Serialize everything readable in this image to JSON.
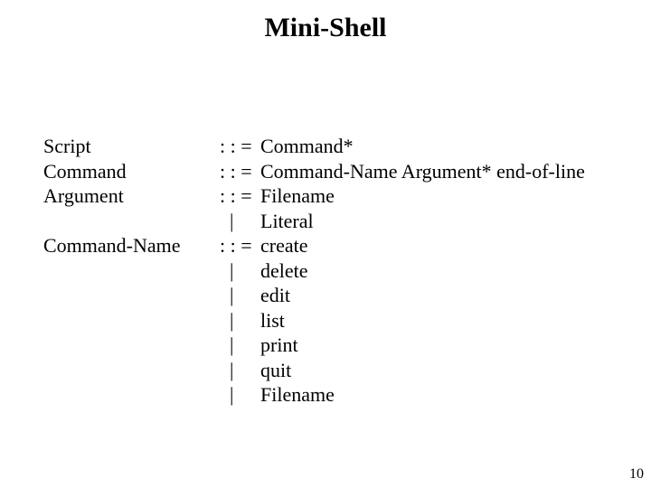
{
  "title": "Mini-Shell",
  "grammar": {
    "rows": [
      {
        "lhs": "Script",
        "op": ": : =",
        "rhs": "Command*"
      },
      {
        "lhs": "Command",
        "op": ": : =",
        "rhs": "Command-Name Argument* end-of-line"
      },
      {
        "lhs": "Argument",
        "op": ": : =",
        "rhs": "Filename"
      },
      {
        "lhs": "",
        "op": "  |",
        "rhs": "Literal"
      },
      {
        "lhs": "Command-Name",
        "op": ": : =",
        "rhs": "create"
      },
      {
        "lhs": "",
        "op": "  |",
        "rhs": "delete"
      },
      {
        "lhs": "",
        "op": "  |",
        "rhs": "edit"
      },
      {
        "lhs": "",
        "op": "  |",
        "rhs": "list"
      },
      {
        "lhs": "",
        "op": "  |",
        "rhs": "print"
      },
      {
        "lhs": "",
        "op": "  |",
        "rhs": "quit"
      },
      {
        "lhs": "",
        "op": "  |",
        "rhs": "Filename"
      }
    ]
  },
  "page_number": "10"
}
